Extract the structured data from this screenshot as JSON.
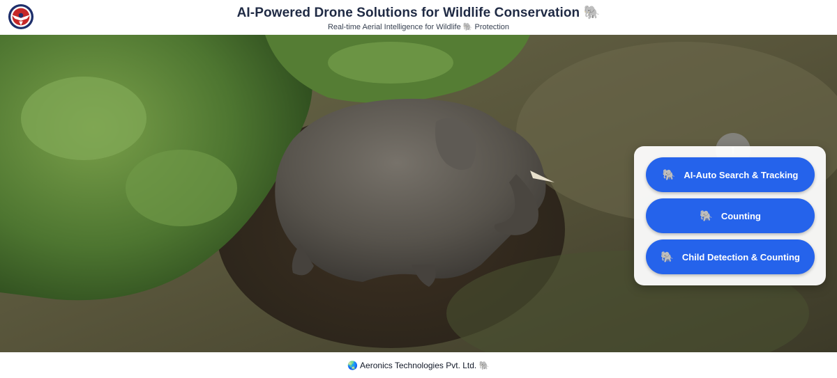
{
  "header": {
    "logo_icon": "winged-emblem-logo",
    "title": "AI-Powered Drone Solutions for Wildlife Conservation",
    "title_emoji": "🐘",
    "subtitle_before": "Real-time Aerial Intelligence for Wildlife",
    "subtitle_emoji": "🐘",
    "subtitle_after": "Protection"
  },
  "hero": {
    "image": "aerial-photo-elephant-resting-in-grass",
    "scroll_top_label": "↑"
  },
  "actions": [
    {
      "icon": "🐘",
      "label": "AI-Auto Search & Tracking"
    },
    {
      "icon": "🐘",
      "label": "Counting"
    },
    {
      "icon": "🐘",
      "label": "Child Detection & Counting"
    }
  ],
  "footer": {
    "globe_icon": "🌏",
    "company": "Aeronics Technologies Pvt. Ltd.",
    "emoji": "🐘"
  },
  "colors": {
    "accent": "#2563eb",
    "title": "#1f2a44"
  }
}
